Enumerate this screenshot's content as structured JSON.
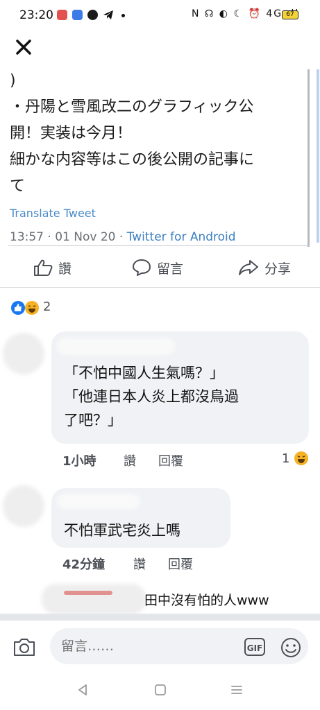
{
  "status_bar": {
    "time": "23:20",
    "icons_text": "N ☊ ◐ ☾ ⏰ 4G ıll",
    "battery": "67"
  },
  "header": {
    "close_icon": "close-icon"
  },
  "tweet": {
    "text": ")\n・丹陽と雪風改二のグラフィック公\n開！実装は今月！\n細かな内容等はこの後公開の記事に\nて",
    "translate_label": "Translate Tweet",
    "timestamp": "13:57 · 01 Nov 20 · ",
    "source": "Twitter for Android"
  },
  "actions": {
    "like_label": "讚",
    "comment_label": "留言",
    "share_label": "分享"
  },
  "reactions": {
    "count": "2"
  },
  "comments": [
    {
      "lines": [
        "「不怕中國人生氣嗎？」",
        "「他連日本人炎上都沒鳥過",
        "了吧？」"
      ],
      "time": "1小時",
      "like_label": "讚",
      "reply_label": "回覆",
      "reaction_count": "1"
    },
    {
      "lines": [
        "不怕軍武宅炎上嗎"
      ],
      "time": "42分鐘",
      "like_label": "讚",
      "reply_label": "回覆"
    },
    {
      "lines": [
        "田中沒有怕的人www"
      ]
    }
  ],
  "input": {
    "placeholder": "留言……",
    "gif_label": "GIF"
  },
  "colors": {
    "brand_blue": "#1877f2",
    "bubble_bg": "#f0f2f5",
    "link_blue": "#3d7fc1"
  }
}
